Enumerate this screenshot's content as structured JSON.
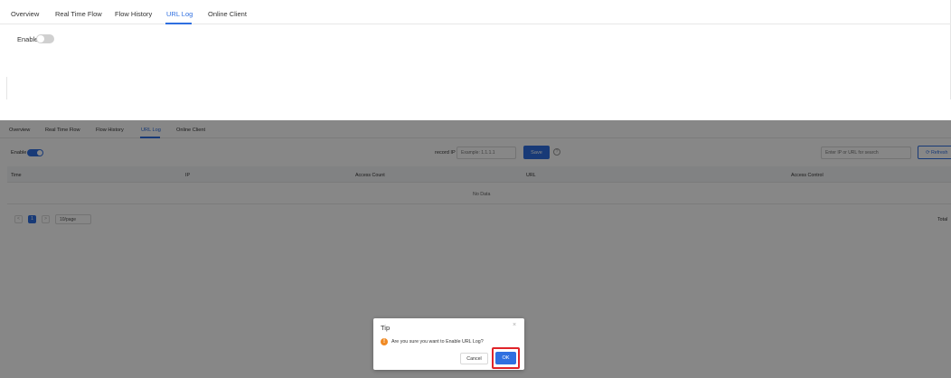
{
  "tabs": [
    "Overview",
    "Real Time Flow",
    "Flow History",
    "URL Log",
    "Online Client"
  ],
  "active_tab": "URL Log",
  "top_panel": {
    "enable_label": "Enable",
    "enable_state": "off"
  },
  "bottom_panel": {
    "enable_label": "Enable",
    "enable_state": "on",
    "record_ip_label": "record IP",
    "record_ip_placeholder": "Example: 1.1.1.1",
    "save_label": "Save",
    "help_glyph": "?",
    "search_placeholder": "Enter IP or URL for search",
    "refresh_label": "Refresh",
    "table": {
      "columns": [
        "Time",
        "IP",
        "Access Count",
        "URL",
        "Access Control"
      ],
      "empty_text": "No Data"
    },
    "pagination": {
      "prev_glyph": "<",
      "current_page": "1",
      "next_glyph": ">",
      "page_size": "10/page",
      "total_label": "Total"
    }
  },
  "dialog": {
    "title": "Tip",
    "close_glyph": "×",
    "warn_glyph": "!",
    "message": "Are you sure you want to Enable URL Log?",
    "cancel_label": "Cancel",
    "ok_label": "OK"
  },
  "colors": {
    "accent": "#2f6fe0",
    "overlay": "rgba(0,0,0,0.47)",
    "highlight": "#e0242a",
    "warning": "#f08a24"
  }
}
